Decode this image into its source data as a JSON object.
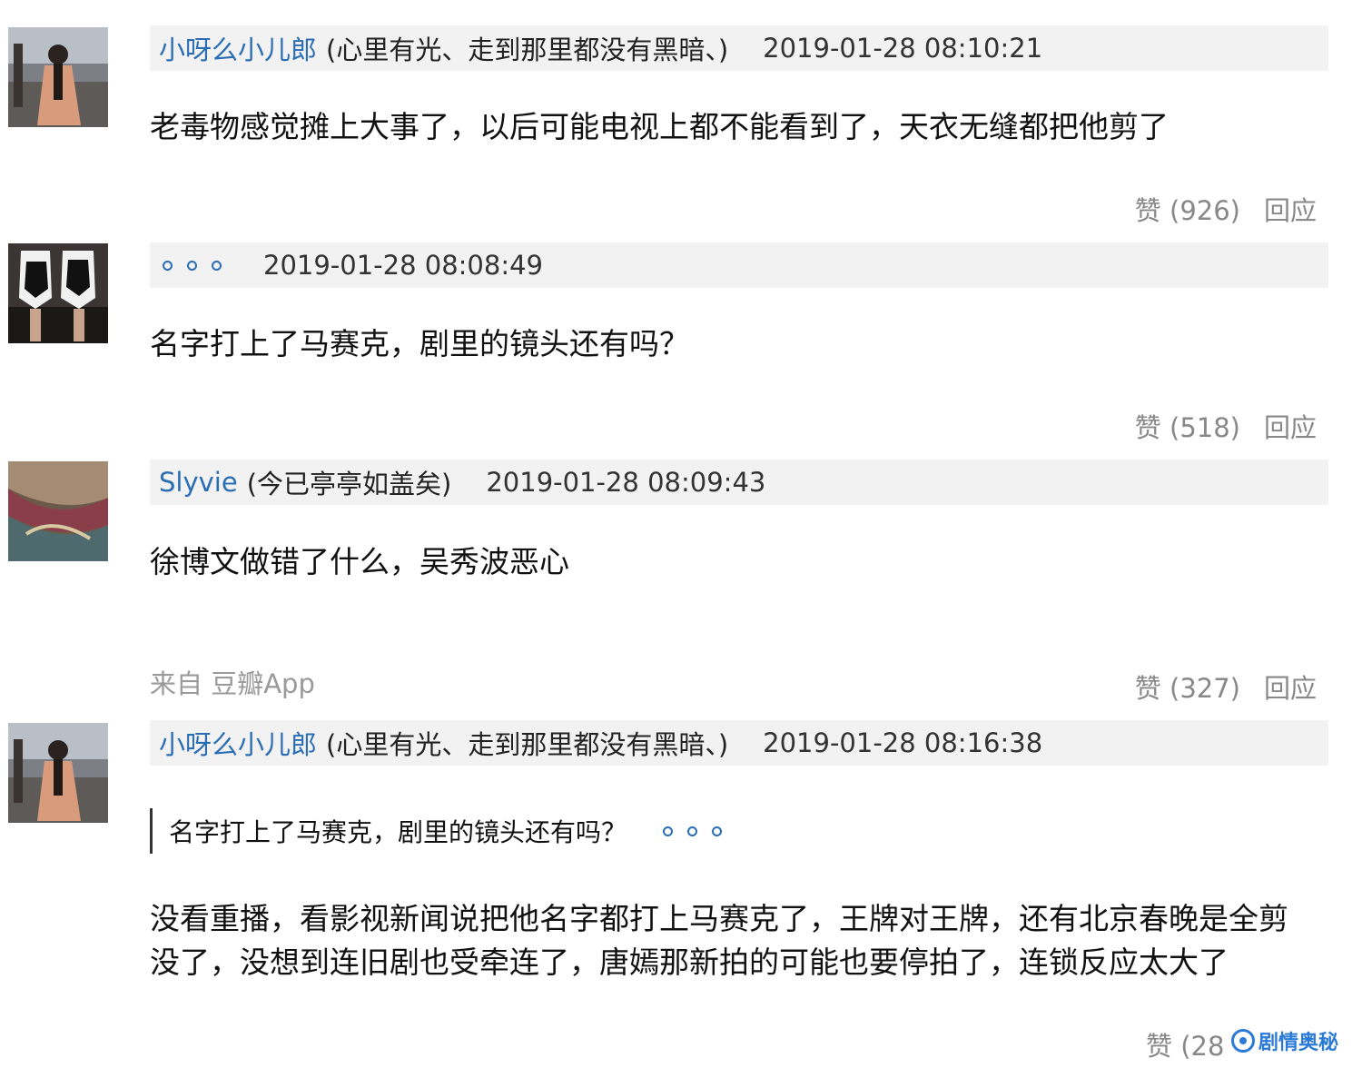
{
  "comments": [
    {
      "author": "小呀么小儿郎",
      "signature": "(心里有光、走到那里都没有黑暗、)",
      "time": "2019-01-28 08:10:21",
      "text": "老毒物感觉摊上大事了，以后可能电视上都不能看到了，天衣无缝都把他剪了",
      "likes": "赞 (926)",
      "reply": "回应"
    },
    {
      "author": "",
      "time": "2019-01-28 08:08:49",
      "text": "名字打上了马赛克，剧里的镜头还有吗？",
      "likes": "赞 (518)",
      "reply": "回应"
    },
    {
      "author": "Slyvie",
      "signature": "(今已亭亭如盖矣)",
      "time": "2019-01-28 08:09:43",
      "text": "徐博文做错了什么，吴秀波恶心",
      "source": "来自 豆瓣App",
      "likes": "赞 (327)",
      "reply": "回应"
    },
    {
      "author": "小呀么小儿郎",
      "signature": "(心里有光、走到那里都没有黑暗、)",
      "time": "2019-01-28 08:16:38",
      "quote": "名字打上了马赛克，剧里的镜头还有吗？",
      "text": "没看重播，看影视新闻说把他名字都打上马赛克了，王牌对王牌，还有北京春晚是全剪没了，没想到连旧剧也受牵连了，唐嫣那新拍的可能也要停拍了，连锁反应太大了",
      "likes": "赞 (28"
    }
  ],
  "watermark": {
    "text": "剧情奥秘"
  },
  "colors": {
    "link": "#2a6db3",
    "meta_bg": "#f2f2f2",
    "muted": "#888888"
  }
}
